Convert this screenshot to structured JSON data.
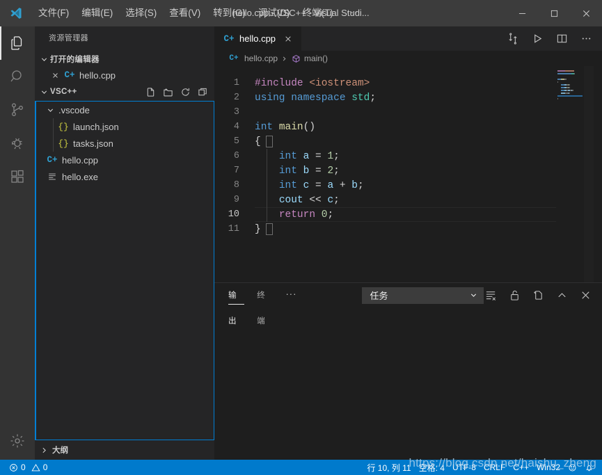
{
  "titlebar": {
    "app_title": "hello.cpp - VSC++ - Visual Studi...",
    "menu": [
      {
        "label": "文件(F)",
        "name": "menu-file"
      },
      {
        "label": "编辑(E)",
        "name": "menu-edit"
      },
      {
        "label": "选择(S)",
        "name": "menu-selection"
      },
      {
        "label": "查看(V)",
        "name": "menu-view"
      },
      {
        "label": "转到(G)",
        "name": "menu-go"
      },
      {
        "label": "调试(D)",
        "name": "menu-debug"
      },
      {
        "label": "终端(T)",
        "name": "menu-terminal"
      }
    ],
    "menu_more": "···",
    "minimize": "minimize",
    "maximize": "maximize",
    "close": "close"
  },
  "activitybar": {
    "items": [
      {
        "name": "explorer",
        "icon": "files-icon",
        "active": true
      },
      {
        "name": "search",
        "icon": "search-icon",
        "active": false
      },
      {
        "name": "source-control",
        "icon": "source-control-icon",
        "active": false
      },
      {
        "name": "debug",
        "icon": "debug-icon",
        "active": false
      },
      {
        "name": "extensions",
        "icon": "extensions-icon",
        "active": false
      }
    ],
    "settings_icon": "gear-icon"
  },
  "sidebar": {
    "title": "资源管理器",
    "open_editors": {
      "label": "打开的编辑器",
      "items": [
        {
          "name": "hello.cpp",
          "icon": "cpp-file-icon",
          "close_icon": "close-icon"
        }
      ]
    },
    "workspace": {
      "label": "VSC++",
      "actions": [
        {
          "name": "new-file-button",
          "icon": "new-file-icon"
        },
        {
          "name": "new-folder-button",
          "icon": "new-folder-icon"
        },
        {
          "name": "refresh-button",
          "icon": "refresh-icon"
        },
        {
          "name": "collapse-all-button",
          "icon": "collapse-all-icon"
        }
      ]
    },
    "tree": [
      {
        "label": ".vscode",
        "type": "folder",
        "expanded": true,
        "depth": 1,
        "icon": "chevron-down-icon"
      },
      {
        "label": "launch.json",
        "type": "json",
        "depth": 2,
        "icon": "json-file-icon"
      },
      {
        "label": "tasks.json",
        "type": "json",
        "depth": 2,
        "icon": "json-file-icon"
      },
      {
        "label": "hello.cpp",
        "type": "cpp",
        "depth": 1,
        "icon": "cpp-file-icon"
      },
      {
        "label": "hello.exe",
        "type": "binary",
        "depth": 1,
        "icon": "binary-file-icon"
      }
    ],
    "outline": {
      "label": "大纲",
      "collapsed": true,
      "icon": "chevron-right-icon"
    }
  },
  "editor": {
    "tab": {
      "label": "hello.cpp",
      "icon": "cpp-file-icon",
      "close_icon": "close-icon"
    },
    "tab_actions": [
      {
        "name": "run-build-task-button",
        "icon": "split-sync-icon"
      },
      {
        "name": "run-code-button",
        "icon": "play-icon"
      },
      {
        "name": "split-editor-button",
        "icon": "split-editor-icon"
      },
      {
        "name": "more-actions-button",
        "icon": "ellipsis-icon"
      }
    ],
    "breadcrumb": [
      {
        "label": "hello.cpp",
        "icon": "cpp-file-icon"
      },
      {
        "label": "main()",
        "icon": "symbol-method-icon"
      }
    ],
    "language": "cpp",
    "lines": [
      {
        "num": 1,
        "tokens": [
          {
            "t": "#include ",
            "c": "t-pre"
          },
          {
            "t": "<iostream>",
            "c": "t-str"
          }
        ]
      },
      {
        "num": 2,
        "tokens": [
          {
            "t": "using ",
            "c": "t-kw"
          },
          {
            "t": "namespace ",
            "c": "t-kw"
          },
          {
            "t": "std",
            "c": "t-ns"
          },
          {
            "t": ";",
            "c": "t-punct"
          }
        ]
      },
      {
        "num": 3,
        "tokens": []
      },
      {
        "num": 4,
        "tokens": [
          {
            "t": "int ",
            "c": "t-kw"
          },
          {
            "t": "main",
            "c": "t-func"
          },
          {
            "t": "()",
            "c": "t-punct"
          }
        ]
      },
      {
        "num": 5,
        "tokens": [
          {
            "t": "{",
            "c": "t-punct"
          }
        ]
      },
      {
        "num": 6,
        "tokens": [
          {
            "t": "    ",
            "c": "t-punct"
          },
          {
            "t": "int ",
            "c": "t-kw"
          },
          {
            "t": "a ",
            "c": "t-id"
          },
          {
            "t": "= ",
            "c": "t-op"
          },
          {
            "t": "1",
            "c": "t-num"
          },
          {
            "t": ";",
            "c": "t-punct"
          }
        ]
      },
      {
        "num": 7,
        "tokens": [
          {
            "t": "    ",
            "c": "t-punct"
          },
          {
            "t": "int ",
            "c": "t-kw"
          },
          {
            "t": "b ",
            "c": "t-id"
          },
          {
            "t": "= ",
            "c": "t-op"
          },
          {
            "t": "2",
            "c": "t-num"
          },
          {
            "t": ";",
            "c": "t-punct"
          }
        ]
      },
      {
        "num": 8,
        "tokens": [
          {
            "t": "    ",
            "c": "t-punct"
          },
          {
            "t": "int ",
            "c": "t-kw"
          },
          {
            "t": "c ",
            "c": "t-id"
          },
          {
            "t": "= ",
            "c": "t-op"
          },
          {
            "t": "a ",
            "c": "t-id"
          },
          {
            "t": "+ ",
            "c": "t-op"
          },
          {
            "t": "b",
            "c": "t-id"
          },
          {
            "t": ";",
            "c": "t-punct"
          }
        ]
      },
      {
        "num": 9,
        "tokens": [
          {
            "t": "    ",
            "c": "t-punct"
          },
          {
            "t": "cout ",
            "c": "t-id"
          },
          {
            "t": "<< ",
            "c": "t-op"
          },
          {
            "t": "c",
            "c": "t-id"
          },
          {
            "t": ";",
            "c": "t-punct"
          }
        ]
      },
      {
        "num": 10,
        "tokens": [
          {
            "t": "    ",
            "c": "t-punct"
          },
          {
            "t": "return ",
            "c": "t-ctrl"
          },
          {
            "t": "0",
            "c": "t-num"
          },
          {
            "t": ";",
            "c": "t-punct"
          }
        ],
        "current": true
      },
      {
        "num": 11,
        "tokens": [
          {
            "t": "}",
            "c": "t-punct"
          }
        ]
      }
    ]
  },
  "panel": {
    "tabs": [
      {
        "label": "输出",
        "name": "tab-output",
        "active": true
      },
      {
        "label": "终端",
        "name": "tab-terminal",
        "active": false
      }
    ],
    "more": "···",
    "channel_select": {
      "value": "任务",
      "name": "output-channel-select"
    },
    "actions": [
      {
        "name": "clear-output-button",
        "icon": "clear-icon"
      },
      {
        "name": "lock-scroll-button",
        "icon": "unlock-icon"
      },
      {
        "name": "open-in-editor-button",
        "icon": "open-editor-icon"
      },
      {
        "name": "maximize-panel-button",
        "icon": "chevron-up-icon"
      },
      {
        "name": "close-panel-button",
        "icon": "close-icon"
      }
    ],
    "content": ""
  },
  "statusbar": {
    "errors": "0",
    "warnings": "0",
    "error_icon": "error-circle-icon",
    "warning_icon": "warning-triangle-icon",
    "cursor_position": "行 10, 列 11",
    "indentation": "空格: 4",
    "encoding": "UTF-8",
    "eol": "CRLF",
    "language_mode": "C++",
    "platform": "Win32",
    "feedback_icon": "feedback-smiley-icon",
    "notification_icon": "bell-icon"
  },
  "watermark": "https://blog.csdn.net/haishu_zheng",
  "colors": {
    "accent": "#007acc",
    "titlebar_bg": "#3c3c3c",
    "activitybar_bg": "#333333",
    "sidebar_bg": "#252526",
    "editor_bg": "#1e1e1e",
    "focus_border": "#007fd4"
  }
}
